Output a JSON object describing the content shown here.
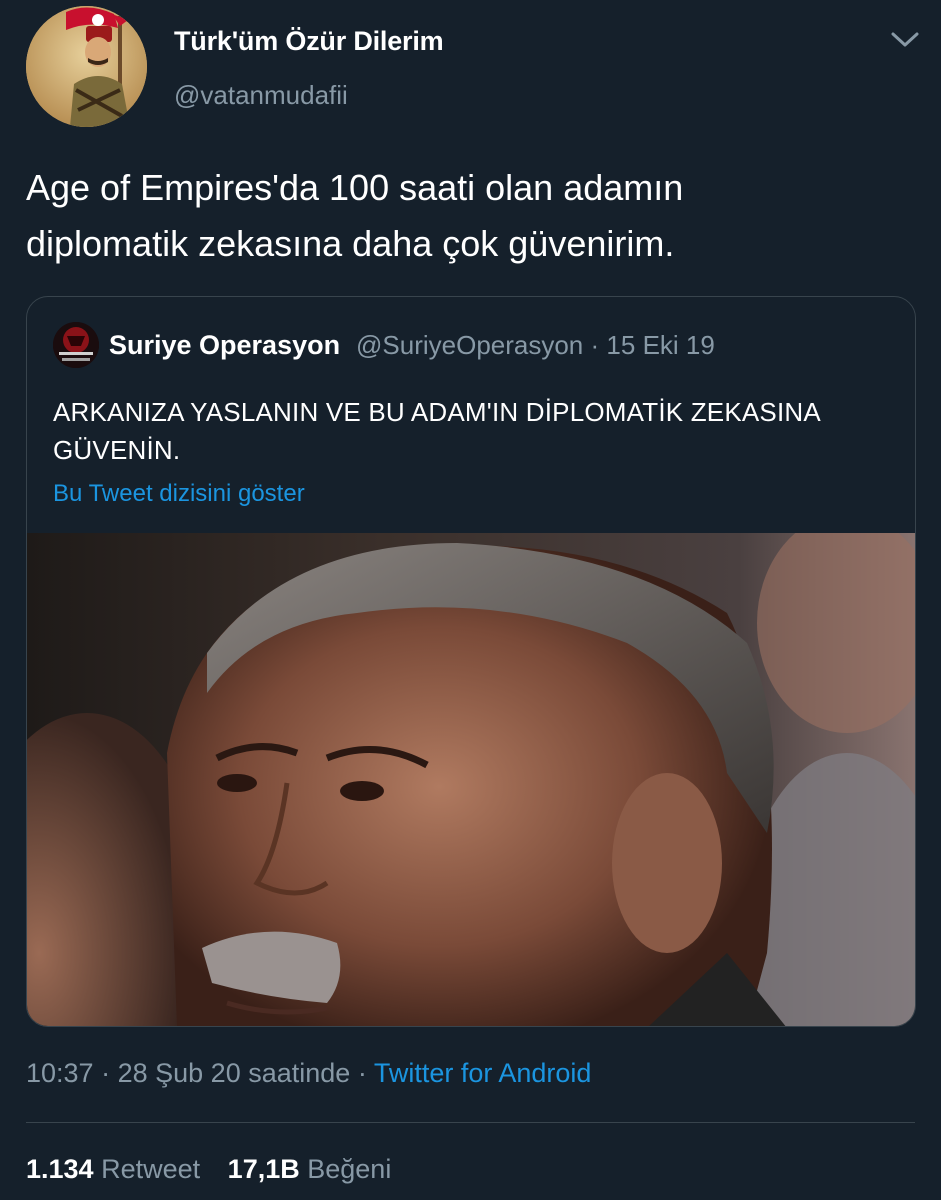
{
  "author": {
    "display_name": "Türk'üm Özür Dilerim",
    "handle": "@vatanmudafii",
    "avatar_icon": "soldier-portrait-avatar"
  },
  "tweet": {
    "text_line1": "Age of Empires'da 100 saati olan adamın",
    "text_line2": "diplomatik zekasına daha çok güvenirim."
  },
  "quoted_tweet": {
    "display_name": "Suriye Operasyon",
    "handle": "@SuriyeOperasyon",
    "separator": "·",
    "date": "15 Eki 19",
    "text_line1": "ARKANIZA YASLANIN VE BU ADAM'IN DİPLOMATİK ZEKASINA",
    "text_line2": "GÜVENİN.",
    "show_thread_link": "Bu Tweet dizisini göster",
    "avatar_icon": "operation-logo-avatar",
    "photo_icon": "portrait-photo"
  },
  "meta": {
    "time": "10:37",
    "separator": "·",
    "date_text": "28 Şub 20 saatinde",
    "separator2": "·",
    "source": "Twitter for Android"
  },
  "stats": {
    "retweets_count": "1.134",
    "retweets_label": "Retweet",
    "likes_count": "17,1B",
    "likes_label": "Beğeni"
  },
  "colors": {
    "background": "#15202b",
    "secondary_text": "#8899a6",
    "link": "#1b95e0",
    "border": "#38444d"
  }
}
